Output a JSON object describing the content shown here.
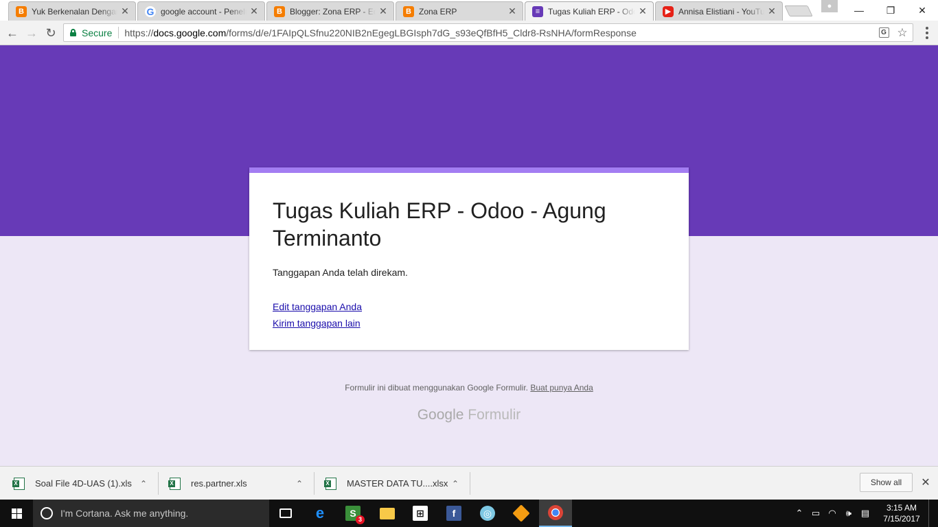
{
  "browser": {
    "tabs": [
      {
        "label": "Yuk Berkenalan Dengan",
        "favicon": "blogger-icon",
        "active": false
      },
      {
        "label": "google account - Penelu",
        "favicon": "google-icon",
        "active": false
      },
      {
        "label": "Blogger: Zona ERP - Edit",
        "favicon": "blogger-icon",
        "active": false
      },
      {
        "label": "Zona ERP",
        "favicon": "blogger-icon",
        "active": false
      },
      {
        "label": "Tugas Kuliah ERP - Odoo",
        "favicon": "forms-icon",
        "active": true
      },
      {
        "label": "Annisa Elistiani - YouTub",
        "favicon": "youtube-icon",
        "active": false
      }
    ],
    "address": {
      "secure_label": "Secure",
      "url_scheme": "https://",
      "url_host": "docs.google.com",
      "url_path": "/forms/d/e/1FAIpQLSfnu220NIB2nEgegLBGIsph7dG_s93eQfBfH5_Cldr8-RsNHA/formResponse"
    }
  },
  "form": {
    "title": "Tugas Kuliah ERP - Odoo - Agung Terminanto",
    "confirmation": "Tanggapan Anda telah direkam.",
    "edit_link": "Edit tanggapan Anda",
    "another_link": "Kirim tanggapan lain",
    "footer_text": "Formulir ini dibuat menggunakan Google Formulir.",
    "footer_link": "Buat punya Anda",
    "logo_google": "Google",
    "logo_forms": "Formulir",
    "colors": {
      "header": "#673ab7",
      "card_accent": "#a37df2",
      "background": "#ede7f6"
    }
  },
  "downloads": {
    "items": [
      {
        "name": "Soal File 4D-UAS (1).xls"
      },
      {
        "name": "res.partner.xls"
      },
      {
        "name": "MASTER DATA TU....xlsx"
      }
    ],
    "show_all": "Show all"
  },
  "taskbar": {
    "cortana_placeholder": "I'm Cortana. Ask me anything.",
    "store_badge": "3",
    "time": "3:15 AM",
    "date": "7/15/2017"
  }
}
